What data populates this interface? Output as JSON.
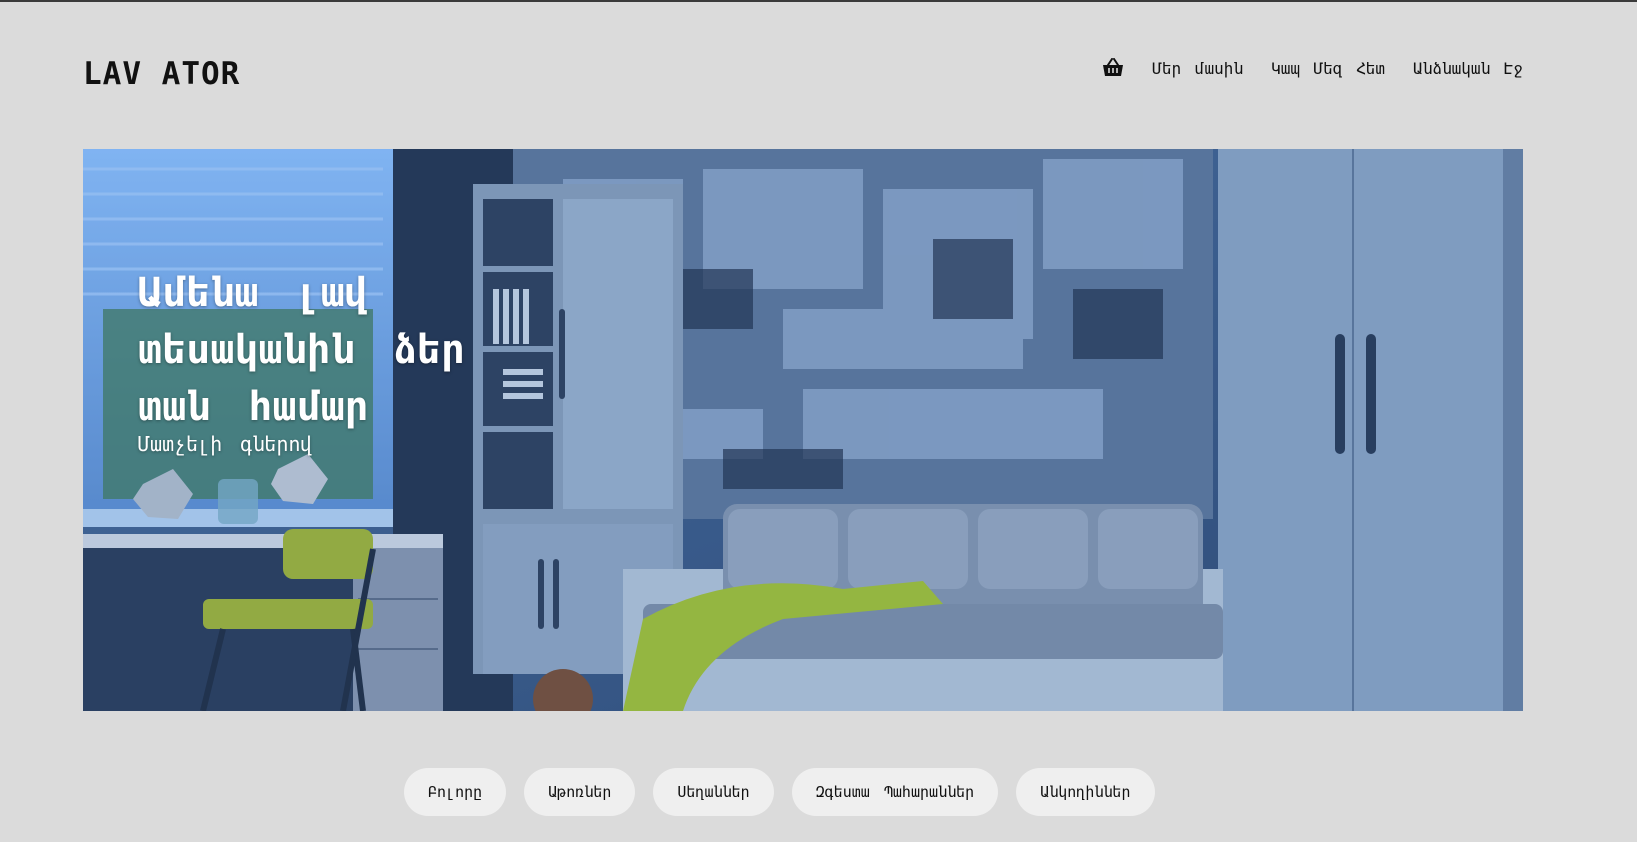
{
  "brand": {
    "logo": "LAV ATOR"
  },
  "nav": {
    "cart_icon": "basket-icon",
    "items": [
      {
        "label": "Մեր մասին"
      },
      {
        "label": "Կապ Մեզ Հետ"
      },
      {
        "label": "Անձնական Էջ"
      }
    ]
  },
  "hero": {
    "title": "Ամենա լավ տեսականին ձեր տան համար",
    "subtitle": "Մատչելի գներով",
    "image": "room-interior-photo",
    "overlay_color": "#3d6fb5"
  },
  "filters": {
    "items": [
      {
        "label": "Բոլորը"
      },
      {
        "label": "Աթոռներ"
      },
      {
        "label": "Սեղաններ"
      },
      {
        "label": "Զգեստա Պահարաններ"
      },
      {
        "label": "Անկողիններ"
      }
    ]
  },
  "colors": {
    "background": "#dbdbdb",
    "pill": "#efefef",
    "text": "#111111"
  }
}
